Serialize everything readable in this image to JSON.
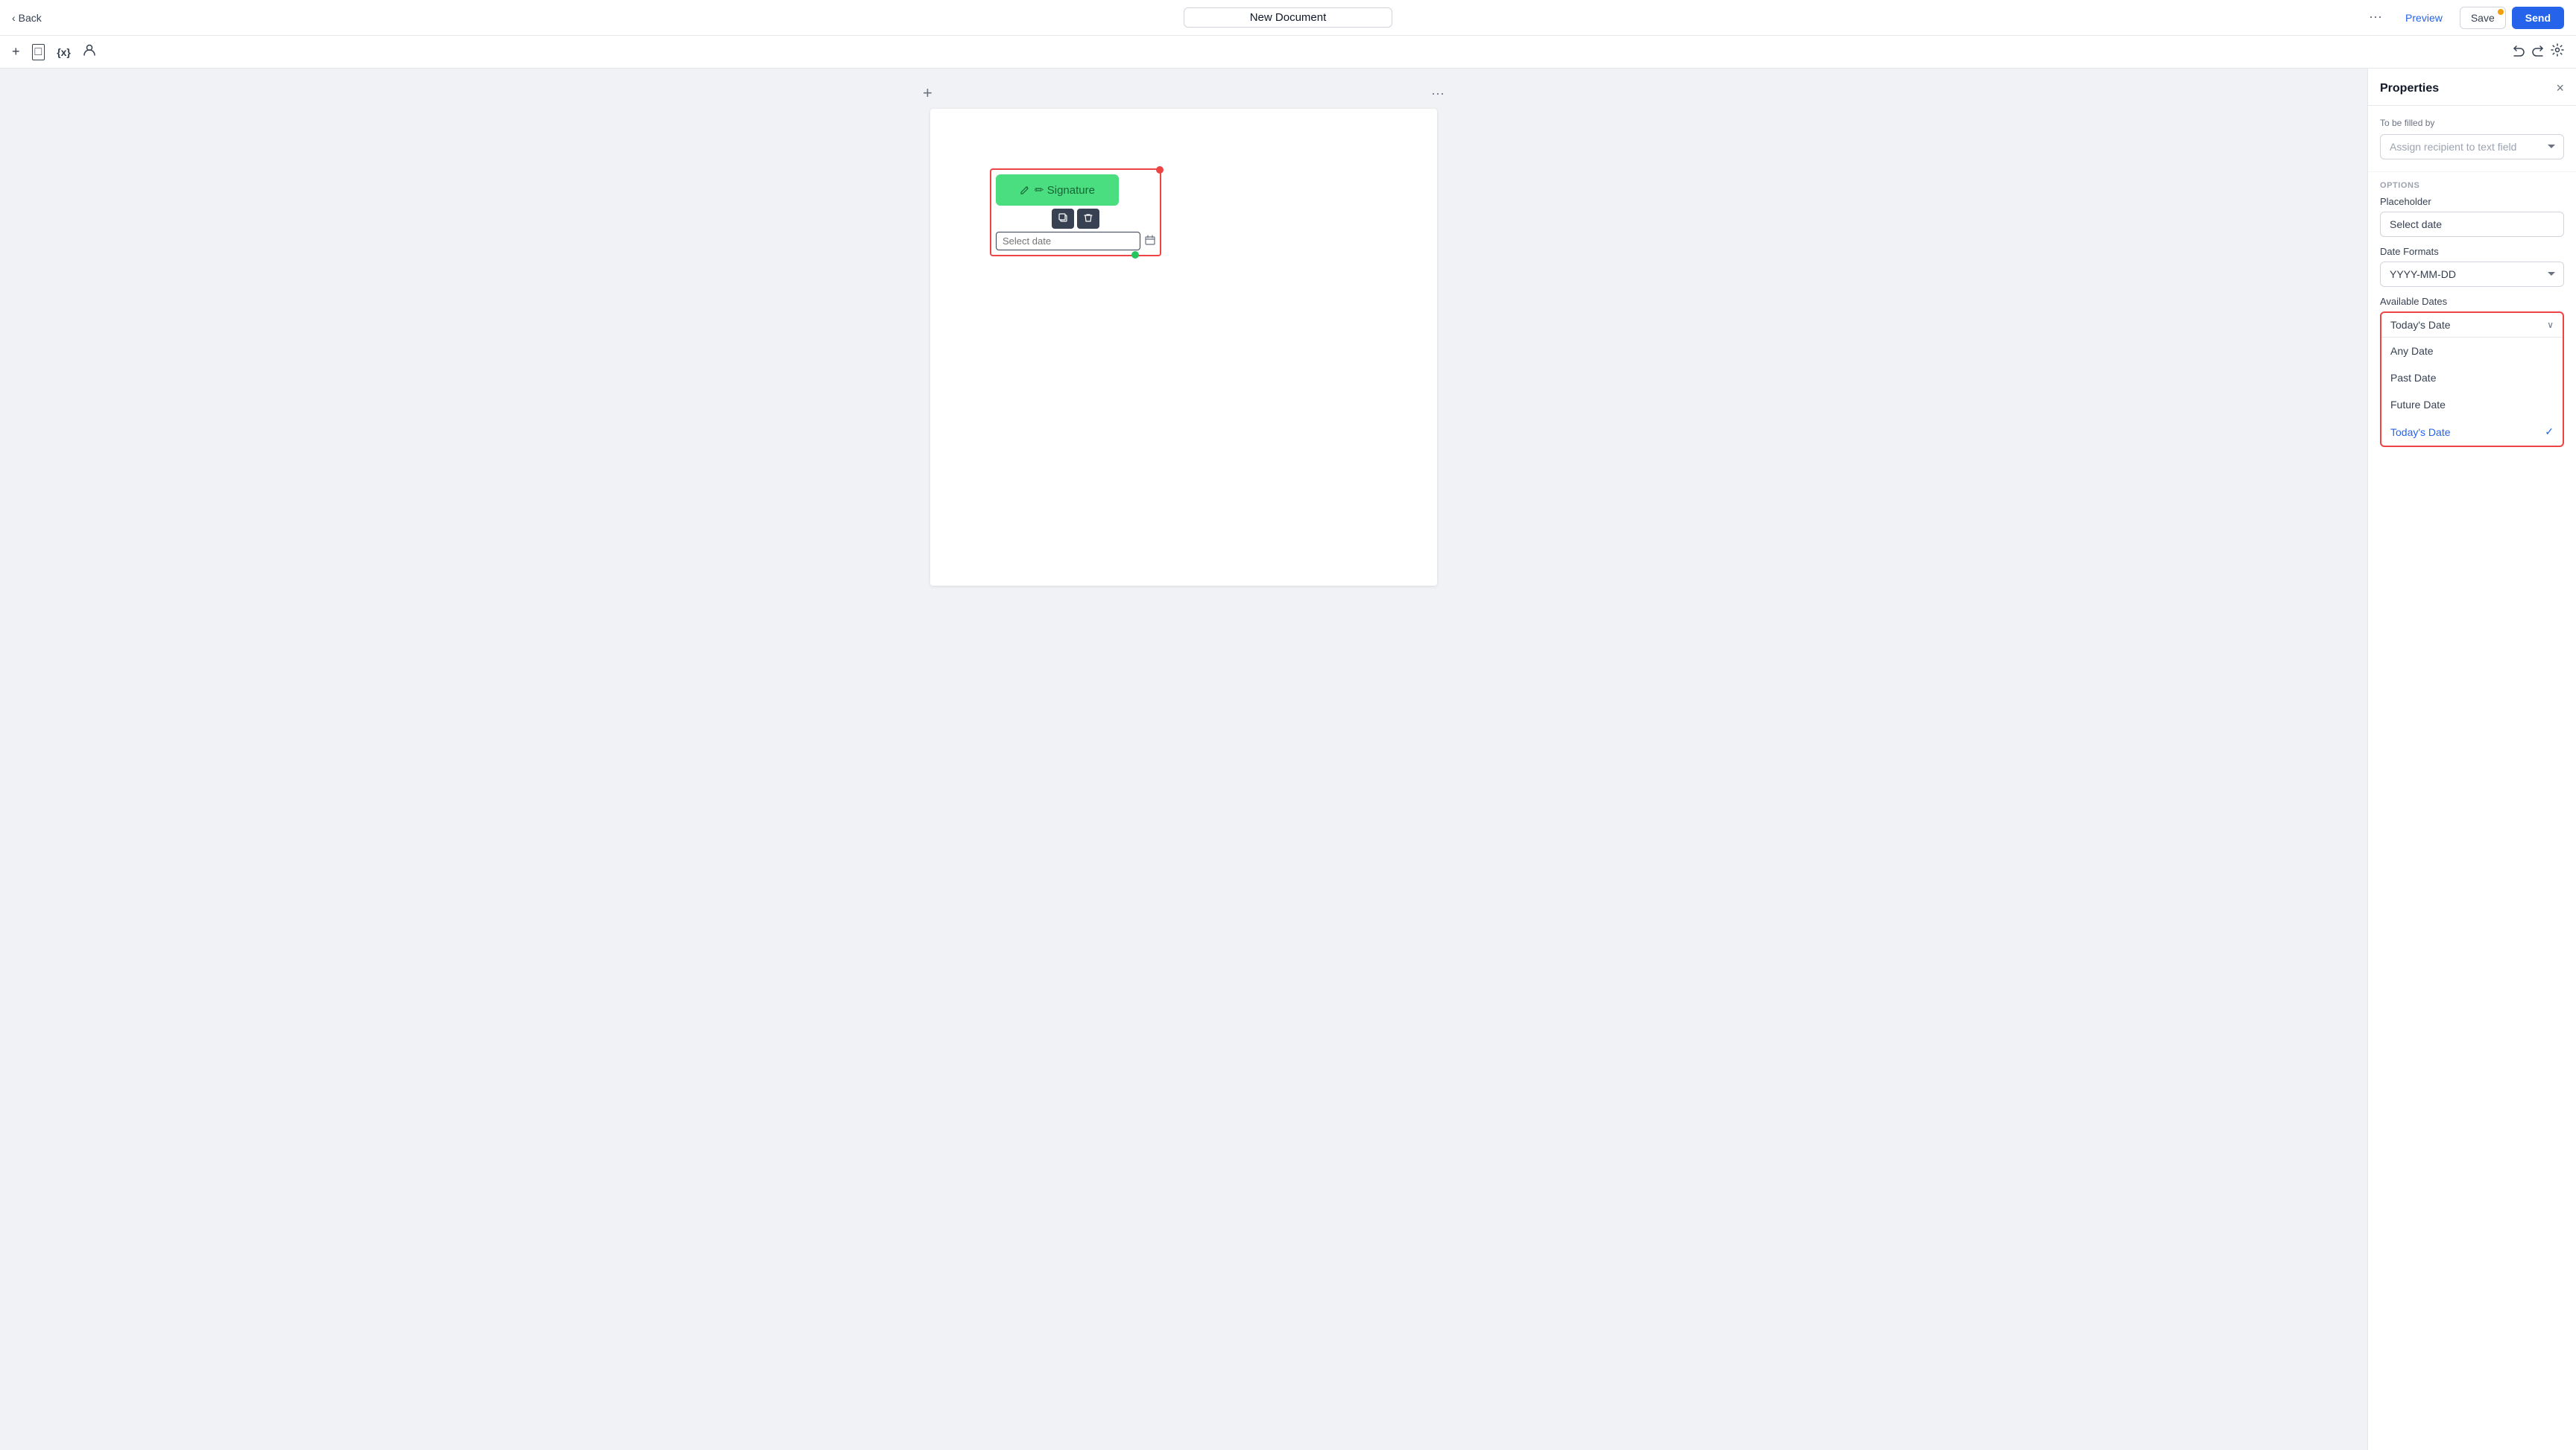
{
  "topNav": {
    "backLabel": "Back",
    "docTitle": "New Document",
    "moreIcon": "⋯",
    "previewLabel": "Preview",
    "saveLabel": "Save",
    "sendLabel": "Send"
  },
  "toolbar": {
    "addIcon": "+",
    "pageIcon": "□",
    "variableIcon": "{x}",
    "personIcon": "👤",
    "undoIcon": "↩",
    "redoIcon": "↪",
    "settingsIcon": "⚙"
  },
  "canvas": {
    "addIcon": "+",
    "moreIcon": "···",
    "signatureBtnLabel": "✏ Signature",
    "dateFieldPlaceholder": "Select date",
    "copyIcon": "⧉",
    "deleteIcon": "🗑"
  },
  "properties": {
    "title": "Properties",
    "closeIcon": "×",
    "toBeFilledByLabel": "To be filled by",
    "recipientPlaceholder": "Assign recipient to text field",
    "optionsLabel": "OPTIONS",
    "placeholderLabel": "Placeholder",
    "placeholderValue": "Select date",
    "dateFormatsLabel": "Date Formats",
    "dateFormatValue": "YYYY-MM-DD",
    "availableDatesLabel": "Available Dates",
    "selectedDate": "Today's Date",
    "dropdownChevron": "∨",
    "dateOptions": [
      {
        "label": "Any Date",
        "selected": false
      },
      {
        "label": "Past Date",
        "selected": false
      },
      {
        "label": "Future Date",
        "selected": false
      },
      {
        "label": "Today's Date",
        "selected": true
      }
    ],
    "checkIcon": "✓"
  }
}
